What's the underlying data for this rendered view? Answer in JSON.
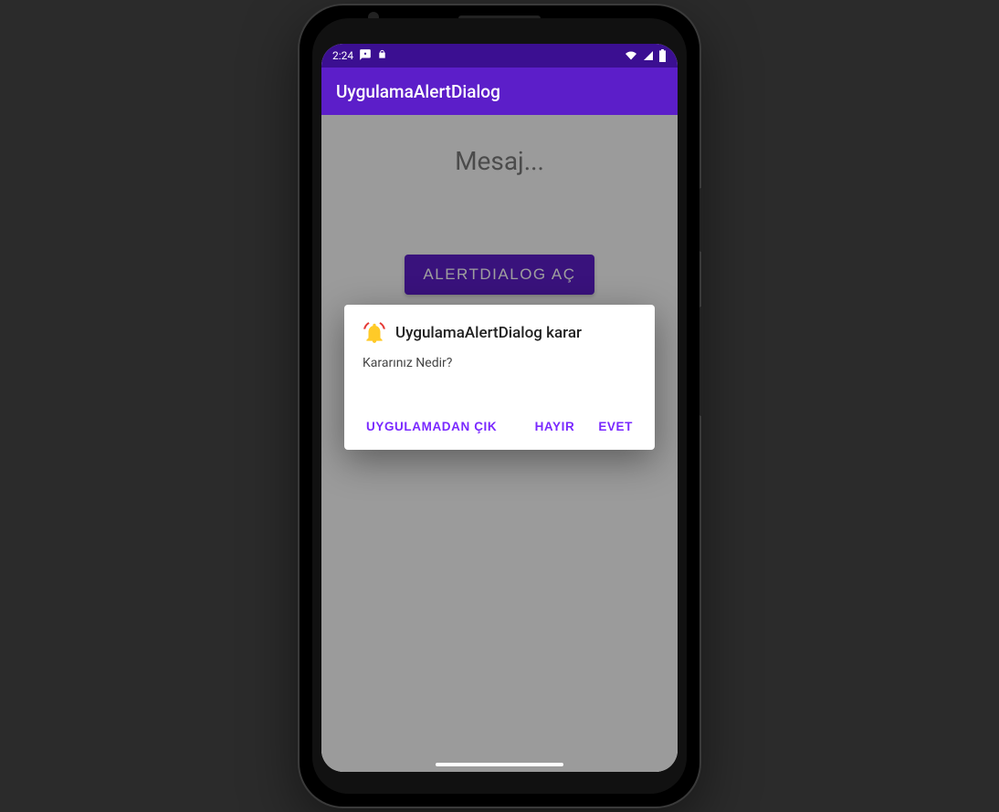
{
  "status": {
    "time": "2:24",
    "dot_icon": "•",
    "lock_icon": "lock"
  },
  "app_bar": {
    "title": "UygulamaAlertDialog"
  },
  "content": {
    "placeholder_text": "Mesaj...",
    "open_button_label": "ALERTDIALOG AÇ"
  },
  "dialog": {
    "title": "UygulamaAlertDialog karar",
    "message": "Kararınız Nedir?",
    "neutral_button": "UYGULAMADAN ÇIK",
    "negative_button": "HAYIR",
    "positive_button": "EVET"
  },
  "colors": {
    "primary": "#5c1ec9",
    "primary_dark": "#3b0f91",
    "accent_text": "#7a29ff"
  }
}
